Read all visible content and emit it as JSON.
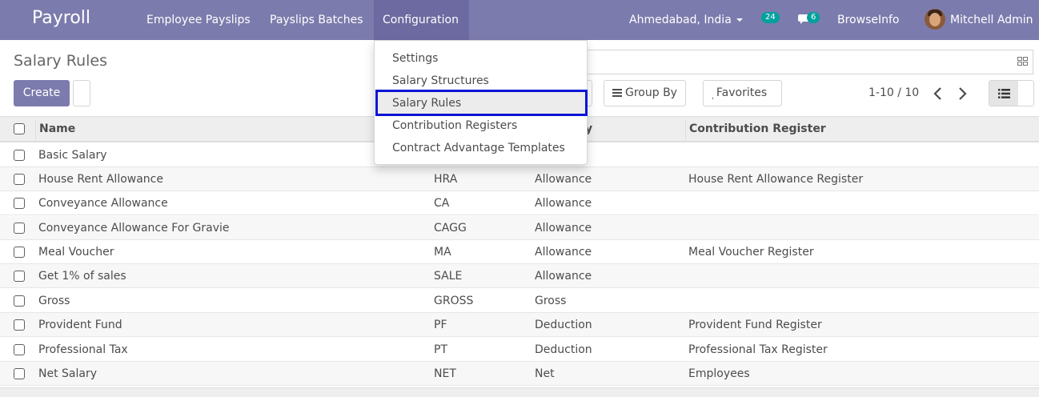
{
  "navbar": {
    "brand": "Payroll",
    "menu": [
      "Employee Payslips",
      "Payslips Batches",
      "Configuration"
    ],
    "location": "Ahmedabad, India",
    "activity_count": "24",
    "message_count": "6",
    "company": "BrowseInfo",
    "user": "Mitchell Admin",
    "colors": {
      "navbar": "#7c7bad",
      "badge": "#00a09d"
    }
  },
  "control_panel": {
    "title": "Salary Rules",
    "create_label": "Create",
    "group_by_label": "Group By",
    "favorites_label": "Favorites",
    "pager": "1-10 / 10"
  },
  "dropdown": {
    "items": [
      "Settings",
      "Salary Structures",
      "Salary Rules",
      "Contribution Registers",
      "Contract Advantage Templates"
    ],
    "selected": "Salary Rules",
    "highlight_color": "#0c14d6"
  },
  "table": {
    "columns": [
      "Name",
      "y",
      "Contribution Register"
    ],
    "rows": [
      {
        "name": "Basic Salary",
        "code": "",
        "category": "",
        "register": ""
      },
      {
        "name": "House Rent Allowance",
        "code": "HRA",
        "category": "Allowance",
        "register": "House Rent Allowance Register"
      },
      {
        "name": "Conveyance Allowance",
        "code": "CA",
        "category": "Allowance",
        "register": ""
      },
      {
        "name": "Conveyance Allowance For Gravie",
        "code": "CAGG",
        "category": "Allowance",
        "register": ""
      },
      {
        "name": "Meal Voucher",
        "code": "MA",
        "category": "Allowance",
        "register": "Meal Voucher Register"
      },
      {
        "name": "Get 1% of sales",
        "code": "SALE",
        "category": "Allowance",
        "register": ""
      },
      {
        "name": "Gross",
        "code": "GROSS",
        "category": "Gross",
        "register": ""
      },
      {
        "name": "Provident Fund",
        "code": "PF",
        "category": "Deduction",
        "register": "Provident Fund Register"
      },
      {
        "name": "Professional Tax",
        "code": "PT",
        "category": "Deduction",
        "register": "Professional Tax Register"
      },
      {
        "name": "Net Salary",
        "code": "NET",
        "category": "Net",
        "register": "Employees"
      }
    ]
  }
}
